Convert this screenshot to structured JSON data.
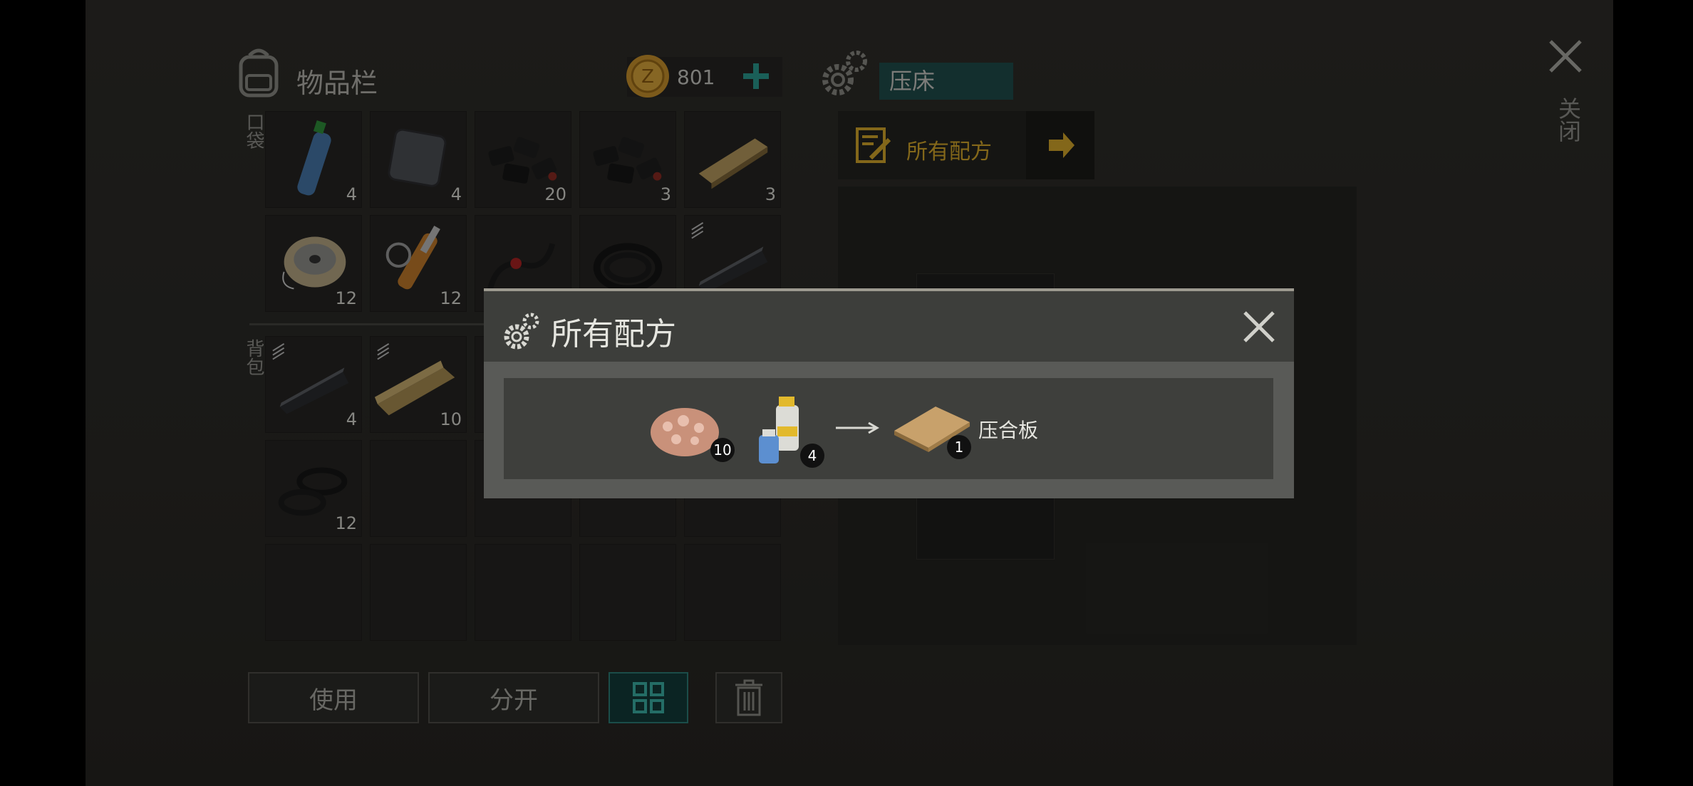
{
  "inventory": {
    "title": "物品栏",
    "pocket_label": "口袋",
    "backpack_label": "背包",
    "currency_amount": "801",
    "pocket_items": [
      {
        "icon": "water-bottle-icon",
        "count": "4"
      },
      {
        "icon": "metal-plate-icon",
        "count": "4"
      },
      {
        "icon": "coal-pile-icon",
        "count": "20"
      },
      {
        "icon": "coal-pile-icon",
        "count": "3"
      },
      {
        "icon": "wood-plank-icon",
        "count": "3"
      },
      {
        "icon": "wire-spool-icon",
        "count": "12"
      },
      {
        "icon": "hydraulic-cylinder-icon",
        "count": "12"
      },
      {
        "icon": "cable-icon",
        "count": ""
      },
      {
        "icon": "rubber-hose-icon",
        "count": ""
      },
      {
        "icon": "steel-bar-icon",
        "count": ""
      }
    ],
    "backpack_items": [
      {
        "icon": "steel-bar-icon",
        "count": "4"
      },
      {
        "icon": "wood-beam-icon",
        "count": "10"
      },
      {
        "icon": "rubber-seals-icon",
        "count": "12"
      }
    ],
    "buttons": {
      "use": "使用",
      "split": "分开"
    }
  },
  "workbench": {
    "name": "压床",
    "recipes_tab": "所有配方"
  },
  "close_label": "关闭",
  "modal": {
    "title": "所有配方",
    "recipe": {
      "inputs": [
        {
          "icon": "wood-chips-icon",
          "count": "10"
        },
        {
          "icon": "resin-bottles-icon",
          "count": "4"
        }
      ],
      "output": {
        "icon": "plywood-board-icon",
        "count": "1",
        "name": "压合板"
      }
    }
  },
  "colors": {
    "accent_teal": "#1f4d4b",
    "accent_gold": "#d4a72a",
    "panel": "#262522"
  }
}
